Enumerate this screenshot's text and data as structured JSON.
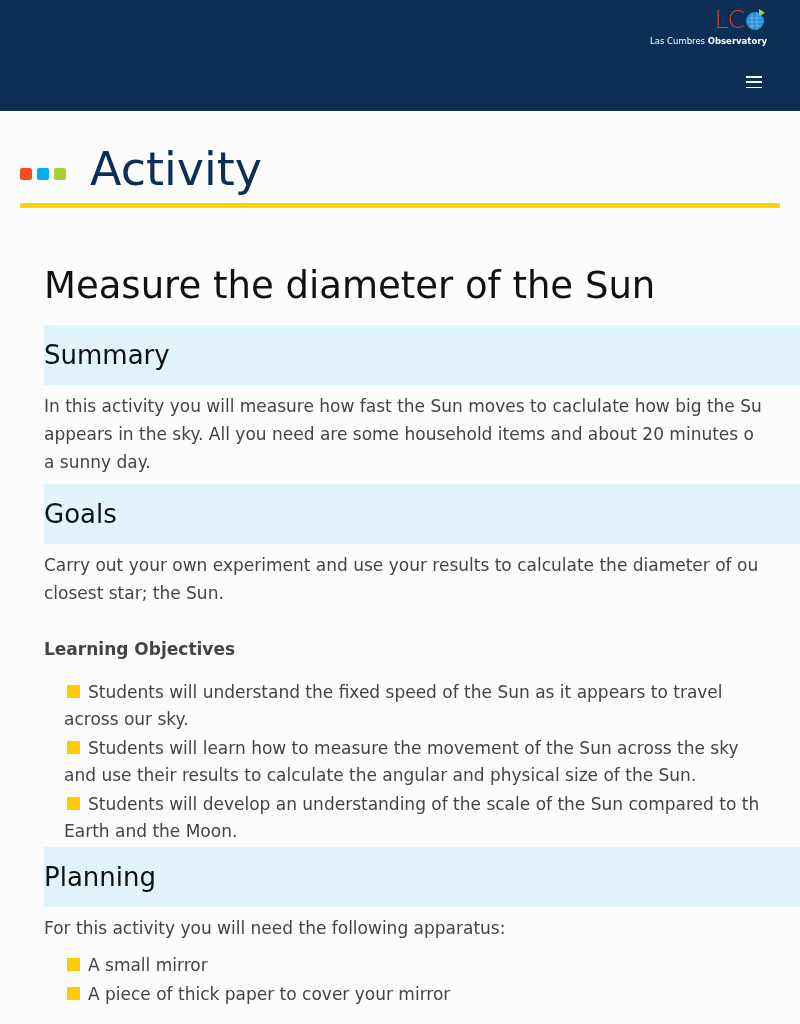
{
  "header": {
    "logo_letters": "LC",
    "logo_text_light": "Las Cumbres",
    "logo_text_bold": "Observatory"
  },
  "page_title": "Activity",
  "activity_title": "Measure the diameter of the Sun",
  "sections": [
    {
      "heading": "Summary",
      "paragraph": "In this activity you will measure how fast the Sun moves to caclulate how big the Su\nappears in the sky. All you need are some household items and about 20 minutes o\na sunny day."
    },
    {
      "heading": "Goals",
      "paragraph": "Carry out your own experiment and use your results to calculate the diameter of ou\nclosest star; the Sun.",
      "subheading": "Learning Objectives",
      "bullets": [
        "Students will understand the fixed speed of the Sun as it appears to travel\nacross our sky.",
        "Students will learn how to measure the movement of the Sun across the sky\nand use their results to calculate the angular and physical size of the Sun.",
        "Students will develop an understanding of the scale of the Sun compared to th\nEarth and the Moon."
      ]
    },
    {
      "heading": "Planning",
      "paragraph": "For this activity you will need the following apparatus:",
      "bullets": [
        "A small mirror",
        "A piece of thick paper to cover your mirror"
      ]
    }
  ]
}
